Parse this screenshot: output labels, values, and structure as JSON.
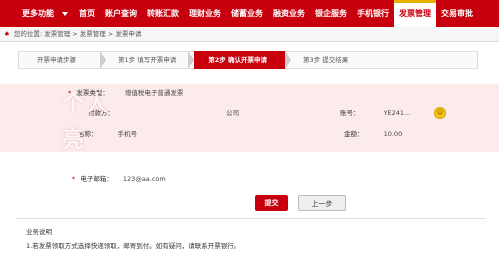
{
  "topnav": {
    "more_label": "更多功能",
    "items": [
      {
        "label": "首页"
      },
      {
        "label": "账户查询"
      },
      {
        "label": "转账汇款"
      },
      {
        "label": "理财业务"
      },
      {
        "label": "储蓄业务"
      },
      {
        "label": "融资业务"
      },
      {
        "label": "银企服务"
      },
      {
        "label": "手机银行"
      },
      {
        "label": "发票管理",
        "active": true
      },
      {
        "label": "交易审批"
      }
    ]
  },
  "breadcrumb": {
    "prefix": "您的位置:",
    "path": "发票管理 > 发票管理 > 发票申请"
  },
  "steps": {
    "title": "开票申请步骤",
    "step1": "第1步  填写开票申请",
    "step2": "第2步  确认开票申请",
    "step3": "第3步  提交结果"
  },
  "form": {
    "invoice_type_label": "发票类型：",
    "invoice_type_value": "增值税电子普通发票",
    "payer_label": "付款方：",
    "payer_value": "公司",
    "account_label": "账号：",
    "account_value": "YE241...",
    "amount_label": "金额：",
    "amount_value": "10.00",
    "name_label": "名称：",
    "name_value": "手机号",
    "email_label": "电子邮箱：",
    "email_value": "123@aa.com"
  },
  "watermark": {
    "line1": "个人",
    "line2": "亮"
  },
  "buttons": {
    "submit": "提交",
    "prev": "上一步"
  },
  "notes": {
    "title": "业务说明",
    "line1": "1.若发票领取方式选择快递领取，邮寄到付。如有疑问，请联系开票银行。"
  },
  "colors": {
    "brand_red": "#c8000e",
    "active_border": "#e8b100"
  }
}
